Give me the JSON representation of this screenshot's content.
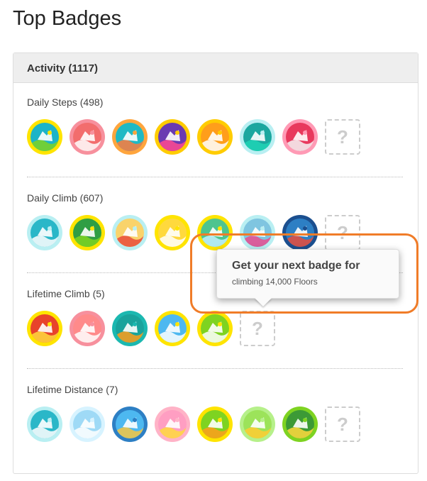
{
  "page": {
    "title": "Top Badges"
  },
  "panel": {
    "header": "Activity (1117)"
  },
  "sections": [
    {
      "title": "Daily Steps (498)",
      "badges": [
        {
          "ring": "#ffe400",
          "bg": "#1cb4c8",
          "fg": "#7ed321",
          "icon": "shoe-icon"
        },
        {
          "ring": "#f7909d",
          "bg": "#f26d6d",
          "fg": "#ffffff",
          "icon": "shoe-icon"
        },
        {
          "ring": "#ffa53d",
          "bg": "#1fb9c4",
          "fg": "#ff7a3d",
          "icon": "shoe-icon"
        },
        {
          "ring": "#ffcc00",
          "bg": "#6a3ab2",
          "fg": "#ff4a8f",
          "icon": "shoe-icon"
        },
        {
          "ring": "#ffcc00",
          "bg": "#ff9e1b",
          "fg": "#ffffff",
          "icon": "shoe-icon"
        },
        {
          "ring": "#b9eff2",
          "bg": "#1ba79f",
          "fg": "#1ed4b5",
          "icon": "shoe-icon"
        },
        {
          "ring": "#ff9ab5",
          "bg": "#e8395d",
          "fg": "#f5f5f5",
          "icon": "shoe-icon"
        }
      ]
    },
    {
      "title": "Daily Climb (607)",
      "badges": [
        {
          "ring": "#b9eff2",
          "bg": "#2ab7c8",
          "fg": "#ffffff",
          "icon": "wave-icon"
        },
        {
          "ring": "#ffe400",
          "bg": "#2f9e44",
          "fg": "#7ed321",
          "icon": "forest-icon"
        },
        {
          "ring": "#b9eff2",
          "bg": "#f9d36b",
          "fg": "#e94c3c",
          "icon": "lighthouse-icon"
        },
        {
          "ring": "#ffe400",
          "bg": "#ffd93d",
          "fg": "#ffffff",
          "icon": "ferris-wheel-icon"
        },
        {
          "ring": "#ffe400",
          "bg": "#4ec48f",
          "fg": "#c2f0ff",
          "icon": "skyscraper-icon"
        },
        {
          "ring": "#b9eff2",
          "bg": "#7fc5e0",
          "fg": "#e94c8f",
          "icon": "city-icon"
        },
        {
          "ring": "#1b4f8f",
          "bg": "#2d7fc4",
          "fg": "#e94c3c",
          "icon": "skyline-icon"
        }
      ]
    },
    {
      "title": "Lifetime Climb (5)",
      "badges": [
        {
          "ring": "#ffe400",
          "bg": "#e8432b",
          "fg": "#ffd93d",
          "icon": "helicopter-icon"
        },
        {
          "ring": "#f7909d",
          "bg": "#ff8a8a",
          "fg": "#ffffff",
          "icon": "skydiver-icon"
        },
        {
          "ring": "#1bb8b0",
          "bg": "#19a39c",
          "fg": "#ff9e1b",
          "icon": "hot-air-balloon-icon"
        },
        {
          "ring": "#ffe400",
          "bg": "#4db8f0",
          "fg": "#ffffff",
          "icon": "airplane-icon"
        },
        {
          "ring": "#ffe400",
          "bg": "#7ed321",
          "fg": "#ffffff",
          "icon": "cloud-icon"
        }
      ]
    },
    {
      "title": "Lifetime Distance (7)",
      "badges": [
        {
          "ring": "#b9eff2",
          "bg": "#2ab7c8",
          "fg": "#ffffff",
          "icon": "monument-icon"
        },
        {
          "ring": "#d7f3ff",
          "bg": "#9fdaf6",
          "fg": "#ffffff",
          "icon": "surfer-icon"
        },
        {
          "ring": "#2d7fc4",
          "bg": "#4db8f0",
          "fg": "#f5c542",
          "icon": "big-ben-icon"
        },
        {
          "ring": "#ffb3c7",
          "bg": "#ff9ec2",
          "fg": "#ffd93d",
          "icon": "palm-tree-icon"
        },
        {
          "ring": "#ffe400",
          "bg": "#7ed321",
          "fg": "#ff9e1b",
          "icon": "giraffe-icon"
        },
        {
          "ring": "#b6f08a",
          "bg": "#9ce35a",
          "fg": "#ffcc33",
          "icon": "castle-icon"
        },
        {
          "ring": "#7ed321",
          "bg": "#3c9a36",
          "fg": "#ffd93d",
          "icon": "sun-icon"
        }
      ]
    }
  ],
  "placeholder": {
    "label": "?"
  },
  "tooltip": {
    "title": "Get your next badge for",
    "subtitle": "climbing 14,000 Floors"
  },
  "highlight": {
    "color": "#f07c28"
  }
}
